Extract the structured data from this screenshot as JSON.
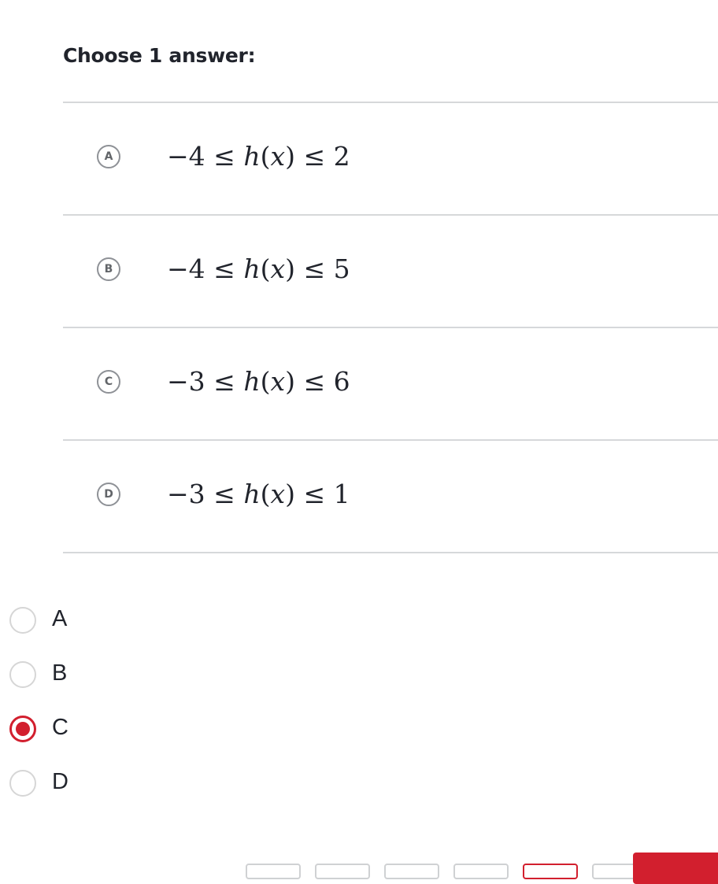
{
  "question": {
    "prompt": "Choose 1 answer:"
  },
  "choices": [
    {
      "letter": "A",
      "lo": "−4",
      "hi": "2"
    },
    {
      "letter": "B",
      "lo": "−4",
      "hi": "5"
    },
    {
      "letter": "C",
      "lo": "−3",
      "hi": "6"
    },
    {
      "letter": "D",
      "lo": "−3",
      "hi": "1"
    }
  ],
  "math": {
    "fn": "h",
    "var": "x",
    "leq": "≤"
  },
  "form": {
    "options": [
      {
        "label": "A",
        "checked": false
      },
      {
        "label": "B",
        "checked": false
      },
      {
        "label": "C",
        "checked": true
      },
      {
        "label": "D",
        "checked": false
      }
    ]
  },
  "colors": {
    "accent": "#d21f2e",
    "divider": "#d6d8da",
    "text": "#21242c"
  }
}
